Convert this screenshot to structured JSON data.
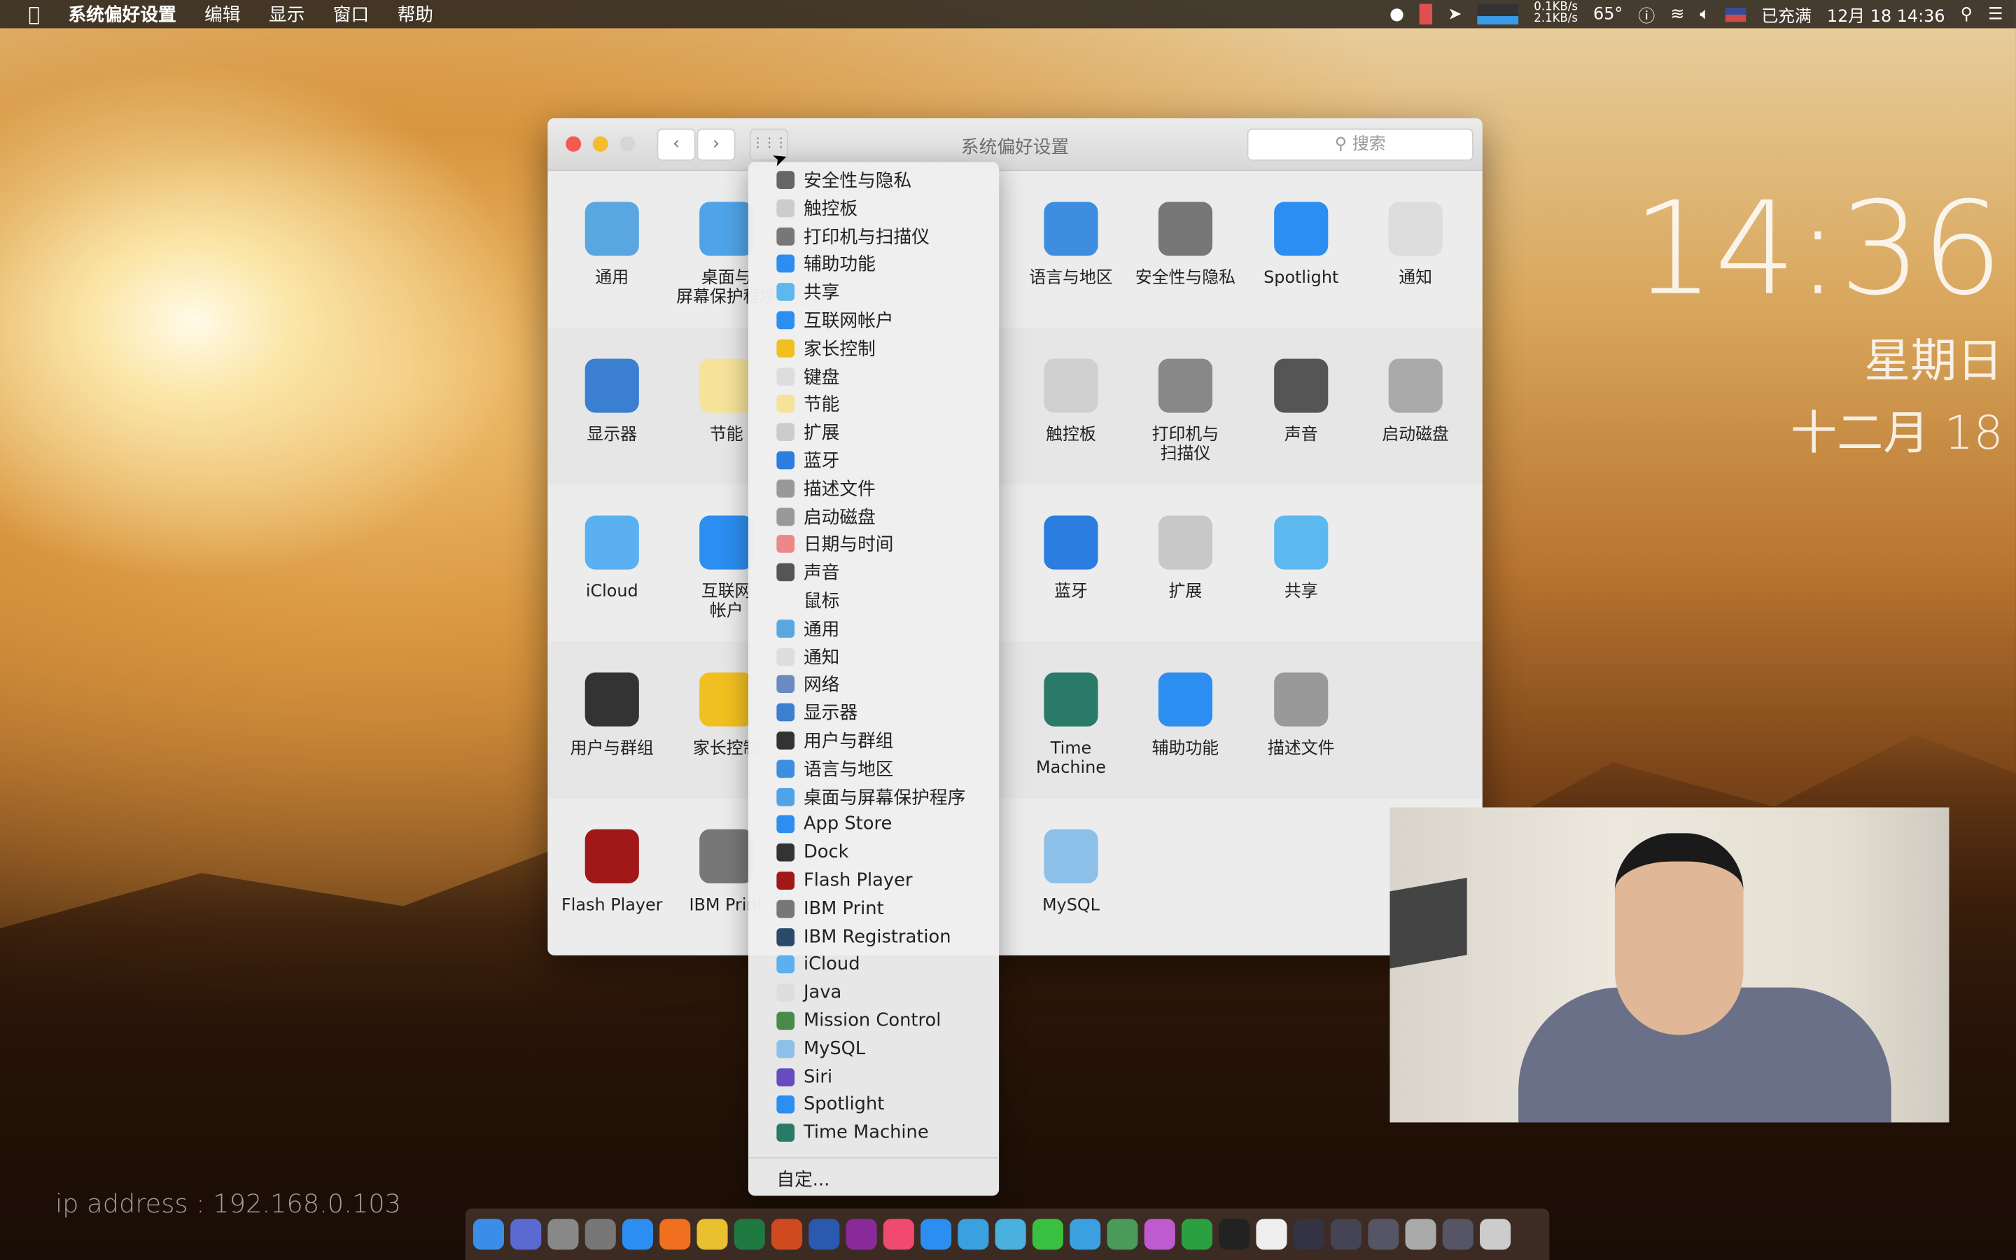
{
  "menubar": {
    "app": "系统偏好设置",
    "items": [
      "编辑",
      "显示",
      "窗口",
      "帮助"
    ],
    "status": {
      "net_up": "0.1KB/s",
      "net_down": "2.1KB/s",
      "temp": "65°",
      "battery": "已充满",
      "datetime": "12月 18 14:36"
    }
  },
  "window": {
    "title": "系统偏好设置",
    "search_placeholder": "搜索",
    "rows": [
      [
        {
          "label": "通用",
          "color": "#5aa6e0"
        },
        {
          "label": "桌面与\n屏幕保护程序",
          "color": "#4fa3e8"
        },
        null,
        null,
        {
          "label": "语言与地区",
          "color": "#3d8ee0"
        },
        {
          "label": "安全性与隐私",
          "color": "#777"
        },
        {
          "label": "Spotlight",
          "color": "#2c8ef0"
        },
        {
          "label": "通知",
          "color": "#ddd"
        }
      ],
      [
        {
          "label": "显示器",
          "color": "#3a7fd0"
        },
        {
          "label": "节能",
          "color": "#f5e39a"
        },
        null,
        null,
        {
          "label": "触控板",
          "color": "#cfcfcf"
        },
        {
          "label": "打印机与\n扫描仪",
          "color": "#888"
        },
        {
          "label": "声音",
          "color": "#555"
        },
        {
          "label": "启动磁盘",
          "color": "#aaa"
        }
      ],
      [
        {
          "label": "iCloud",
          "color": "#5ab0f0"
        },
        {
          "label": "互联网\n帐户",
          "color": "#2c8ef0"
        },
        null,
        null,
        {
          "label": "蓝牙",
          "color": "#2b7de0"
        },
        {
          "label": "扩展",
          "color": "#c8c8c8"
        },
        {
          "label": "共享",
          "color": "#5db8f0"
        }
      ],
      [
        {
          "label": "用户与群组",
          "color": "#333"
        },
        {
          "label": "家长控制",
          "color": "#f0c020"
        },
        null,
        null,
        {
          "label": "Time Machine",
          "color": "#2a7a6a"
        },
        {
          "label": "辅助功能",
          "color": "#2b8ef0"
        },
        {
          "label": "描述文件",
          "color": "#999"
        }
      ],
      [
        {
          "label": "Flash Player",
          "color": "#a01818"
        },
        {
          "label": "IBM Print",
          "color": "#777"
        },
        null,
        null,
        {
          "label": "MySQL",
          "color": "#8cc0e8"
        }
      ]
    ]
  },
  "dropdown": {
    "items": [
      {
        "label": "安全性与隐私",
        "color": "#666"
      },
      {
        "label": "触控板",
        "color": "#ccc"
      },
      {
        "label": "打印机与扫描仪",
        "color": "#777"
      },
      {
        "label": "辅助功能",
        "color": "#2b8ef0"
      },
      {
        "label": "共享",
        "color": "#5db8f0"
      },
      {
        "label": "互联网帐户",
        "color": "#2c8ef0"
      },
      {
        "label": "家长控制",
        "color": "#f0c020"
      },
      {
        "label": "键盘",
        "color": "#ddd"
      },
      {
        "label": "节能",
        "color": "#f5e39a"
      },
      {
        "label": "扩展",
        "color": "#ccc"
      },
      {
        "label": "蓝牙",
        "color": "#2b7de0"
      },
      {
        "label": "描述文件",
        "color": "#999"
      },
      {
        "label": "启动磁盘",
        "color": "#999"
      },
      {
        "label": "日期与时间",
        "color": "#e88"
      },
      {
        "label": "声音",
        "color": "#555"
      },
      {
        "label": "鼠标",
        "color": "#eee"
      },
      {
        "label": "通用",
        "color": "#5aa6e0"
      },
      {
        "label": "通知",
        "color": "#ddd"
      },
      {
        "label": "网络",
        "color": "#6a8ac0"
      },
      {
        "label": "显示器",
        "color": "#3a7fd0"
      },
      {
        "label": "用户与群组",
        "color": "#333"
      },
      {
        "label": "语言与地区",
        "color": "#3d8ee0"
      },
      {
        "label": "桌面与屏幕保护程序",
        "color": "#4fa3e8"
      },
      {
        "label": "App Store",
        "color": "#2c8ef0"
      },
      {
        "label": "Dock",
        "color": "#333"
      },
      {
        "label": "Flash Player",
        "color": "#a01818"
      },
      {
        "label": "IBM Print",
        "color": "#777"
      },
      {
        "label": "IBM Registration",
        "color": "#2a4a6a"
      },
      {
        "label": "iCloud",
        "color": "#5ab0f0"
      },
      {
        "label": "Java",
        "color": "#ddd"
      },
      {
        "label": "Mission Control",
        "color": "#4a8a4a"
      },
      {
        "label": "MySQL",
        "color": "#8cc0e8"
      },
      {
        "label": "Siri",
        "color": "#6a4ac0"
      },
      {
        "label": "Spotlight",
        "color": "#2c8ef0"
      },
      {
        "label": "Time Machine",
        "color": "#2a7a6a"
      }
    ],
    "customize": "自定..."
  },
  "desktop": {
    "time": "14:36",
    "weekday": "星期日",
    "date": "十二月 18",
    "ip": "ip address : 192.168.0.103"
  },
  "dock": {
    "colors": [
      "#3a8ee8",
      "#5a6ad0",
      "#888",
      "#777",
      "#2c8ef0",
      "#f07020",
      "#e8c030",
      "#1e7a40",
      "#d04a20",
      "#2a5ab0",
      "#8a2a9a",
      "#f04a70",
      "#2c8ef0",
      "#3aa0e0",
      "#4ab0e0",
      "#3ac040",
      "#3aa0e0",
      "#4a9a5a",
      "#c05ad0",
      "#2aa040",
      "#222",
      "#eee",
      "#334",
      "#445",
      "#556",
      "#aaa",
      "#556",
      "#ccc"
    ]
  }
}
